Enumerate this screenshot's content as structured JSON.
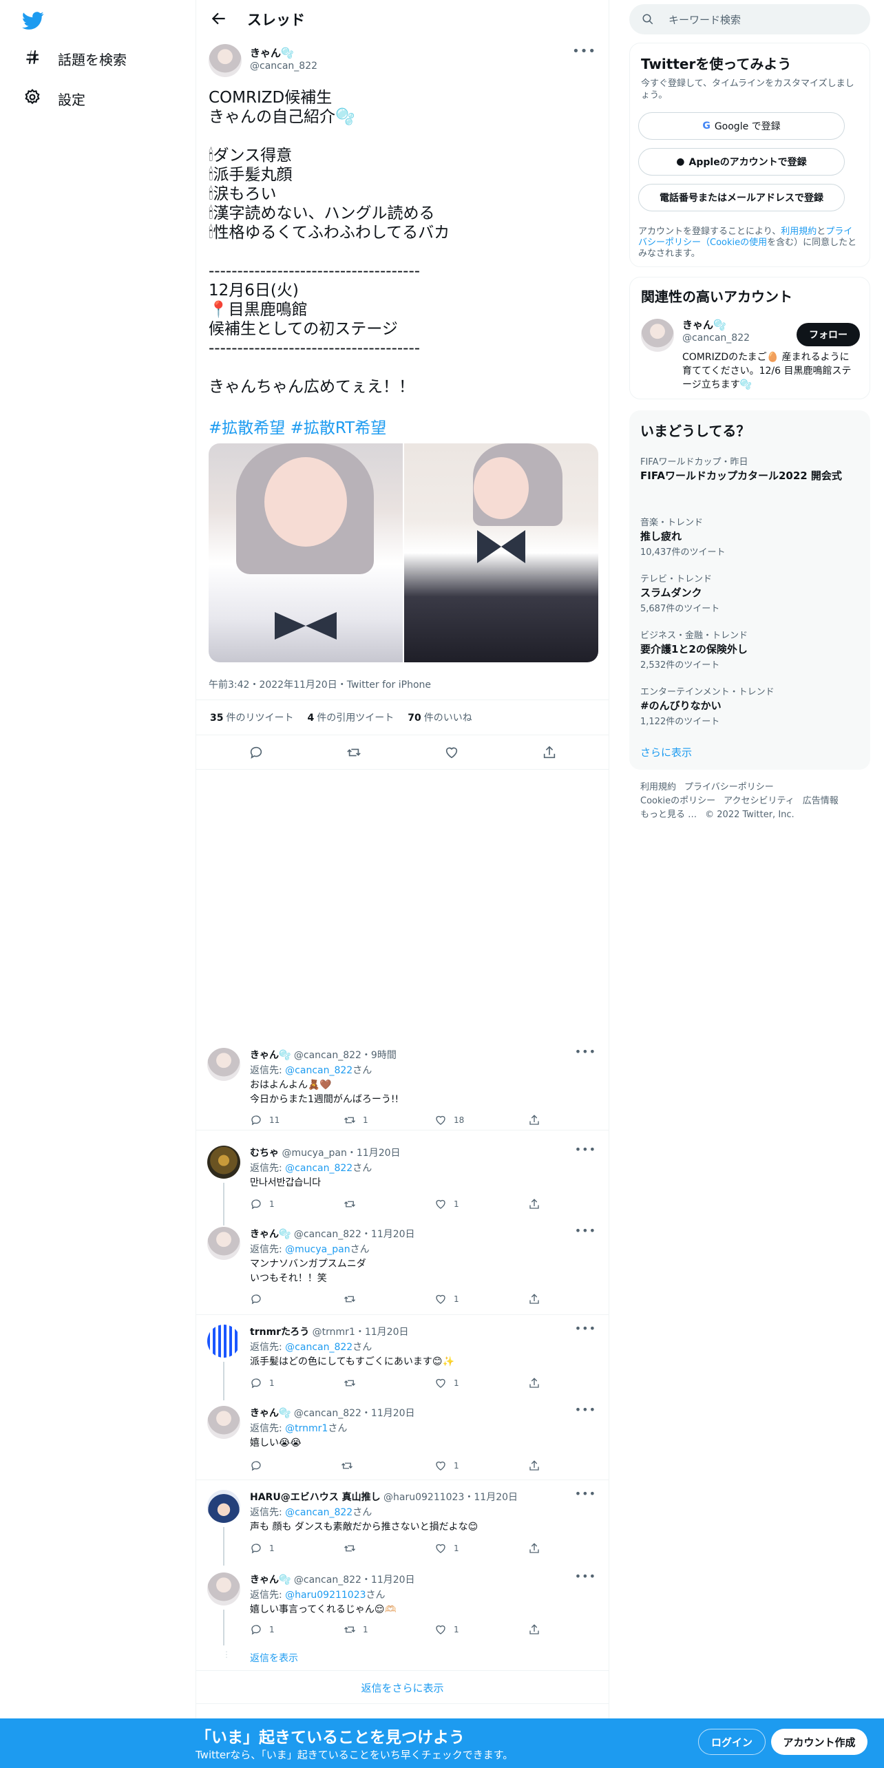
{
  "colors": {
    "accent": "#1d9bf0",
    "text": "#0f1419",
    "secondary": "#536471"
  },
  "nav": {
    "explore": "話題を検索",
    "settings": "設定"
  },
  "header": {
    "title": "スレッド"
  },
  "tweet": {
    "name": "きゃん🫧",
    "handle": "@cancan_822",
    "text": "COMRIZD候補生\nきゃんの自己紹介🫧\n\n🕯ダンス得意\n🕯派手髪丸顔\n🕯涙もろい\n🕯漢字読めない、ハングル読める\n🕯性格ゆるくてふわふわしてるバカ\n\n-------------------------------------\n12月6日(火)\n📍目黒鹿鳴館\n候補生としての初ステージ\n-------------------------------------\n\nきゃんちゃん広めてぇえ！！",
    "hashtags": "#拡散希望 #拡散RT希望",
    "meta": "午前3:42・2022年11月20日・Twitter for iPhone",
    "retweets": "35",
    "retweets_label": "件のリツイート",
    "quotes": "4",
    "quotes_label": "件の引用ツイート",
    "likes": "70",
    "likes_label": "件のいいね"
  },
  "replies": [
    {
      "name": "きゃん🫧",
      "handle": "@cancan_822",
      "time": "9時間",
      "reply_to": "@cancan_822",
      "text": "おはよんよん🧸🤎\n今日からまた1週間がんばろーう!!",
      "replies": "11",
      "retweets": "1",
      "likes": "18"
    },
    {
      "name": "むちゃ",
      "handle": "@mucya_pan",
      "time": "11月20日",
      "reply_to": "@cancan_822",
      "text": "만나서반갑습니다",
      "replies": "1",
      "retweets": "",
      "likes": "1"
    },
    {
      "name": "きゃん🫧",
      "handle": "@cancan_822",
      "time": "11月20日",
      "reply_to": "@mucya_pan",
      "text": "マンナソバンガプスムニダ\nいつもそれ！！笑",
      "replies": "",
      "retweets": "",
      "likes": "1"
    },
    {
      "name": "trnmrたろう",
      "handle": "@trnmr1",
      "time": "11月20日",
      "reply_to": "@cancan_822",
      "text": "派手髪はどの色にしてもすごくにあいます😊✨",
      "replies": "1",
      "retweets": "",
      "likes": "1"
    },
    {
      "name": "きゃん🫧",
      "handle": "@cancan_822",
      "time": "11月20日",
      "reply_to": "@trnmr1",
      "text": "嬉しい😭😭",
      "replies": "",
      "retweets": "",
      "likes": "1"
    },
    {
      "name": "HARU@エビハウス 真山推し",
      "handle": "@haru09211023",
      "time": "11月20日",
      "reply_to": "@cancan_822",
      "text": "声も 顔も ダンスも素敵だから推さないと損だよな😊",
      "replies": "1",
      "retweets": "",
      "likes": "1"
    },
    {
      "name": "きゃん🫧",
      "handle": "@cancan_822",
      "time": "11月20日",
      "reply_to": "@haru09211023",
      "text": "嬉しい事言ってくれるじゃん😌🫶🏻",
      "replies": "1",
      "retweets": "1",
      "likes": "1"
    }
  ],
  "reply_labels": {
    "reply_to_prefix": "返信先: ",
    "reply_to_suffix": "さん",
    "show_replies": "返信を表示",
    "more_replies": "返信をさらに表示"
  },
  "search": {
    "placeholder": "キーワード検索"
  },
  "signup": {
    "title": "Twitterを使ってみよう",
    "sub": "今すぐ登録して、タイムラインをカスタマイズしましょう。",
    "google": "Google で登録",
    "apple": "Appleのアカウントで登録",
    "phone": "電話番号またはメールアドレスで登録",
    "legal_1": "アカウントを登録することにより、",
    "legal_terms": "利用規約",
    "legal_2": "と",
    "legal_privacy": "プライバシーポリシー（Cookieの使用",
    "legal_3": "を含む）に同意したとみなされます。"
  },
  "related": {
    "title": "関連性の高いアカウント",
    "name": "きゃん🫧",
    "handle": "@cancan_822",
    "follow": "フォロー",
    "bio": "COMRIZDのたまご🥚 産まれるように育ててください。12/6 目黒鹿鳴館ステージ立ちます🫧"
  },
  "trends": {
    "title": "いまどうしてる？",
    "items": [
      {
        "category": "FIFAワールドカップ・昨日",
        "name": "FIFAワールドカップカタール2022 開会式",
        "count": ""
      },
      {
        "category": "音楽・トレンド",
        "name": "推し疲れ",
        "count": "10,437件のツイート"
      },
      {
        "category": "テレビ・トレンド",
        "name": "スラムダンク",
        "count": "5,687件のツイート"
      },
      {
        "category": "ビジネス・金融・トレンド",
        "name": "要介護1と2の保険外し",
        "count": "2,532件のツイート"
      },
      {
        "category": "エンターテインメント・トレンド",
        "name": "#のんびりなかい",
        "count": "1,122件のツイート"
      }
    ],
    "show_more": "さらに表示"
  },
  "footer": {
    "terms": "利用規約",
    "privacy": "プライバシーポリシー",
    "cookies": "Cookieのポリシー",
    "accessibility": "アクセシビリティ",
    "ads": "広告情報",
    "more": "もっと見る …",
    "copyright": "© 2022 Twitter, Inc."
  },
  "bottombar": {
    "title": "「いま」起きていることを見つけよう",
    "sub": "Twitterなら、「いま」起きていることをいち早くチェックできます。",
    "login": "ログイン",
    "signup": "アカウント作成"
  }
}
